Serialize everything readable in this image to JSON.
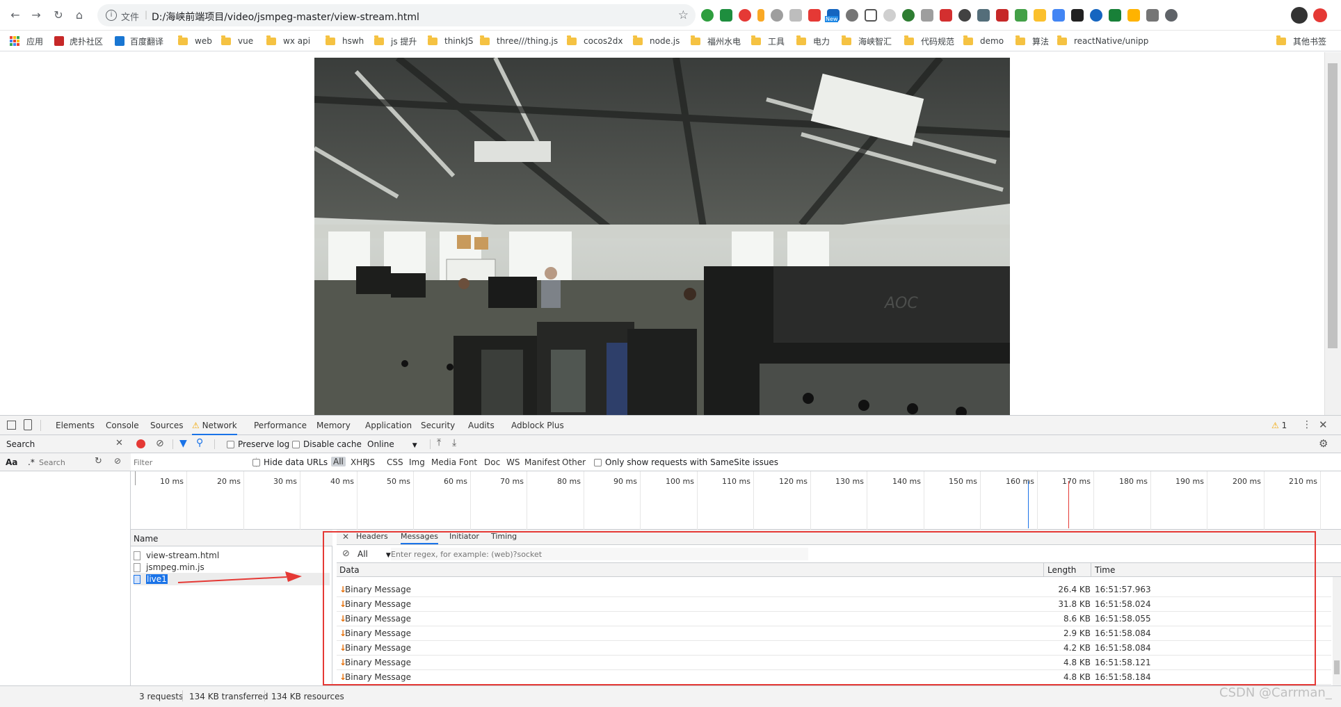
{
  "browser": {
    "file_label": "文件",
    "separator": "|",
    "url": "D:/海峡前端项目/video/jsmpeg-master/view-stream.html"
  },
  "bookmarks": [
    {
      "label": "应用",
      "kind": "apps"
    },
    {
      "label": "虎扑社区",
      "kind": "site"
    },
    {
      "label": "百度翻译",
      "kind": "site"
    },
    {
      "label": "web",
      "kind": "folder"
    },
    {
      "label": "vue",
      "kind": "folder"
    },
    {
      "label": "wx api",
      "kind": "folder"
    },
    {
      "label": "hswh",
      "kind": "folder"
    },
    {
      "label": "js 提升",
      "kind": "folder"
    },
    {
      "label": "thinkJS",
      "kind": "folder"
    },
    {
      "label": "three///thing.js",
      "kind": "folder"
    },
    {
      "label": "cocos2dx",
      "kind": "folder"
    },
    {
      "label": "node.js",
      "kind": "folder"
    },
    {
      "label": "福州水电",
      "kind": "folder"
    },
    {
      "label": "工具",
      "kind": "folder"
    },
    {
      "label": "电力",
      "kind": "folder"
    },
    {
      "label": "海峡智汇",
      "kind": "folder"
    },
    {
      "label": "代码规范",
      "kind": "folder"
    },
    {
      "label": "demo",
      "kind": "folder"
    },
    {
      "label": "算法",
      "kind": "folder"
    },
    {
      "label": "reactNative/unipp",
      "kind": "folder"
    },
    {
      "label": "其他书签",
      "kind": "folder"
    }
  ],
  "extension_new_badge": "New",
  "devtools": {
    "tabs": [
      "Elements",
      "Console",
      "Sources",
      "Network",
      "Performance",
      "Memory",
      "Application",
      "Security",
      "Audits",
      "Adblock Plus"
    ],
    "active_tab": "Network",
    "warning_count": "1",
    "search_title": "Search",
    "search_aa": "Aa",
    "search_regex": ".*",
    "search_placeholder": "Search",
    "network_toolbar": {
      "preserve_log": "Preserve log",
      "disable_cache": "Disable cache",
      "throttle": "Online"
    },
    "filter": {
      "placeholder": "Filter",
      "hide_data_urls": "Hide data URLs",
      "types": [
        "All",
        "XHR",
        "JS",
        "CSS",
        "Img",
        "Media",
        "Font",
        "Doc",
        "WS",
        "Manifest",
        "Other"
      ],
      "samesite": "Only show requests with SameSite issues"
    },
    "timeline_ticks": [
      "10 ms",
      "20 ms",
      "30 ms",
      "40 ms",
      "50 ms",
      "60 ms",
      "70 ms",
      "80 ms",
      "90 ms",
      "100 ms",
      "110 ms",
      "120 ms",
      "130 ms",
      "140 ms",
      "150 ms",
      "160 ms",
      "170 ms",
      "180 ms",
      "190 ms",
      "200 ms",
      "210 ms"
    ],
    "name_header": "Name",
    "requests": [
      "view-stream.html",
      "jsmpeg.min.js",
      "live1"
    ],
    "selected_request": "live1",
    "detail_tabs": [
      "Headers",
      "Messages",
      "Initiator",
      "Timing"
    ],
    "active_detail_tab": "Messages",
    "messages_filter": {
      "option": "All",
      "placeholder": "Enter regex, for example: (web)?socket"
    },
    "messages_columns": {
      "data": "Data",
      "length": "Length",
      "time": "Time"
    },
    "messages": [
      {
        "data": "Binary Message",
        "length": "26.4 KB",
        "time": "16:51:57.963"
      },
      {
        "data": "Binary Message",
        "length": "31.8 KB",
        "time": "16:51:58.024"
      },
      {
        "data": "Binary Message",
        "length": "8.6 KB",
        "time": "16:51:58.055"
      },
      {
        "data": "Binary Message",
        "length": "2.9 KB",
        "time": "16:51:58.084"
      },
      {
        "data": "Binary Message",
        "length": "4.2 KB",
        "time": "16:51:58.084"
      },
      {
        "data": "Binary Message",
        "length": "4.8 KB",
        "time": "16:51:58.121"
      },
      {
        "data": "Binary Message",
        "length": "4.8 KB",
        "time": "16:51:58.184"
      }
    ],
    "status": {
      "requests": "3 requests",
      "transferred": "134 KB transferred",
      "resources": "134 KB resources"
    }
  },
  "watermark": "CSDN @Carrman_",
  "colors": {
    "accent_blue": "#1a73e8",
    "record_red": "#e53935",
    "annotation_red": "#e53935",
    "message_arrow": "#e8710a"
  }
}
